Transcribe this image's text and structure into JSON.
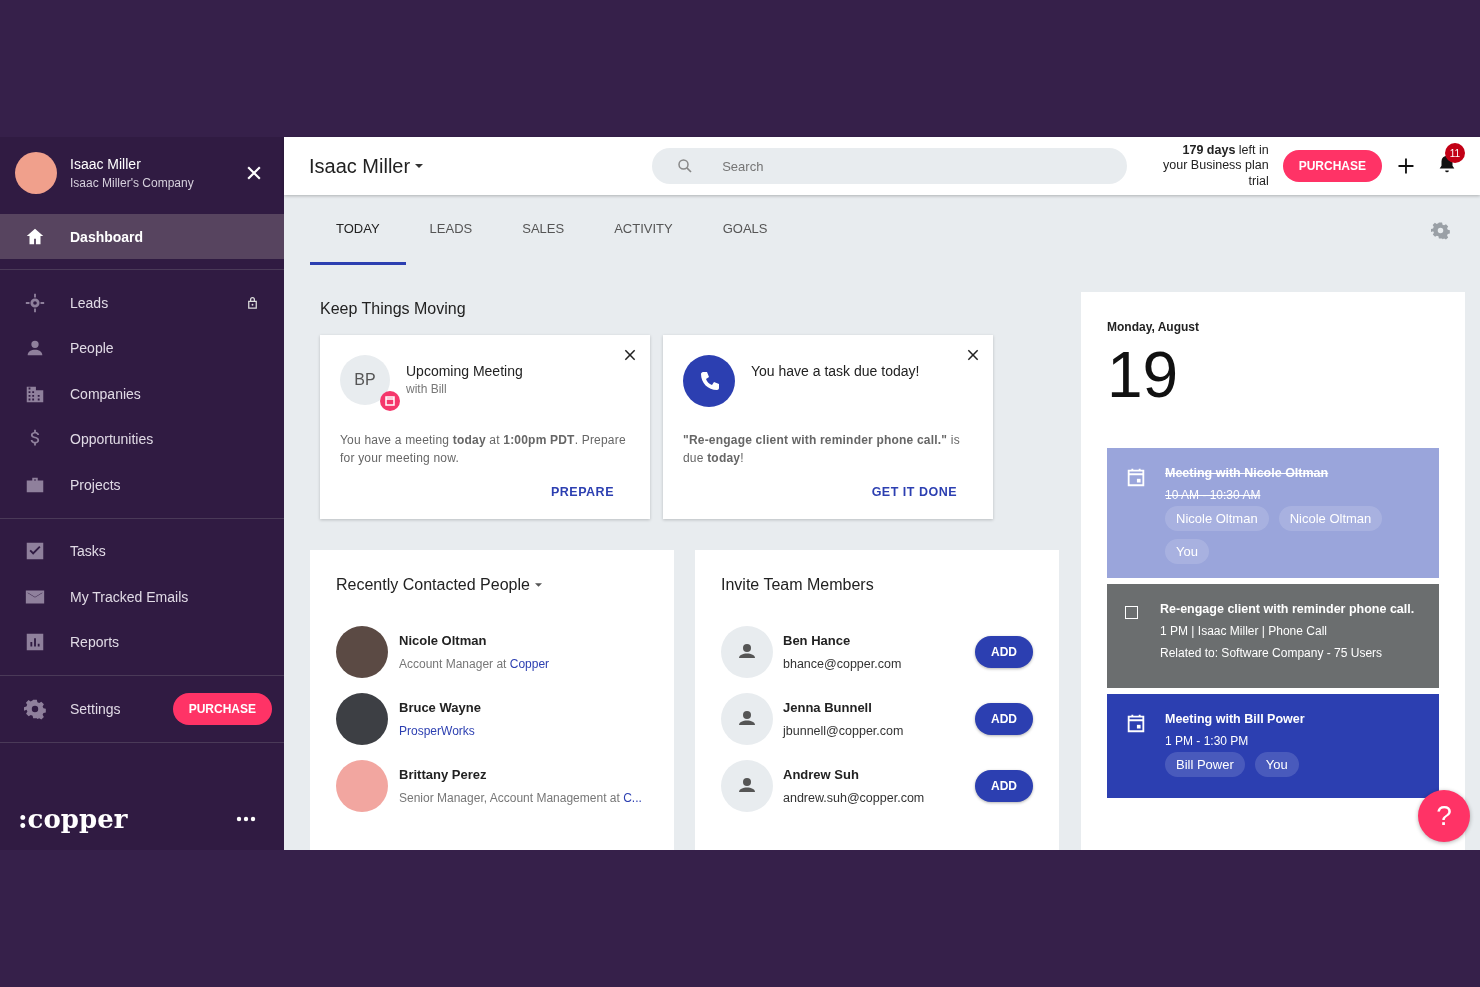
{
  "user": {
    "name": "Isaac Miller",
    "company": "Isaac Miller's Company"
  },
  "sidebar": {
    "sections": [
      {
        "items": [
          {
            "label": "Dashboard",
            "kind": "home",
            "selected": true,
            "locked": false
          }
        ]
      },
      {
        "items": [
          {
            "label": "Leads",
            "kind": "leads",
            "selected": false,
            "locked": true
          },
          {
            "label": "People",
            "kind": "people",
            "selected": false,
            "locked": false
          },
          {
            "label": "Companies",
            "kind": "companies",
            "selected": false,
            "locked": false
          },
          {
            "label": "Opportunities",
            "kind": "opportunities",
            "selected": false,
            "locked": false
          },
          {
            "label": "Projects",
            "kind": "projects",
            "selected": false,
            "locked": false
          }
        ]
      },
      {
        "items": [
          {
            "label": "Tasks",
            "kind": "tasks",
            "selected": false,
            "locked": false
          },
          {
            "label": "My Tracked Emails",
            "kind": "emails",
            "selected": false,
            "locked": false
          },
          {
            "label": "Reports",
            "kind": "reports",
            "selected": false,
            "locked": false
          }
        ]
      },
      {
        "items": [
          {
            "label": "Settings",
            "kind": "settings",
            "selected": false,
            "locked": false,
            "button": "PURCHASE"
          }
        ]
      }
    ]
  },
  "logo": ":copper",
  "header": {
    "title": "Isaac Miller",
    "search": {
      "placeholder": "Search"
    },
    "trial": "**179 days** left in your Business plan trial",
    "purchase": "PURCHASE",
    "notifications": "11"
  },
  "tabs": [
    {
      "label": "TODAY",
      "selected": true
    },
    {
      "label": "LEADS",
      "selected": false
    },
    {
      "label": "SALES",
      "selected": false
    },
    {
      "label": "ACTIVITY",
      "selected": false
    },
    {
      "label": "GOALS",
      "selected": false
    }
  ],
  "keep_moving": {
    "title": "Keep Things Moving",
    "cards": [
      {
        "kind": "meeting",
        "initials": "BP",
        "title": "Upcoming Meeting",
        "subtitle": "with Bill",
        "message": "You have a meeting **today** at **1:00pm PDT**. Prepare for your meeting now.",
        "action": "PREPARE"
      },
      {
        "kind": "task",
        "title": "You have a task due today!",
        "message": "**\"Re-engage client with reminder phone call.\"** is due **today**!",
        "action": "GET IT DONE"
      }
    ]
  },
  "recent": {
    "title": "Recently Contacted People",
    "people": [
      {
        "name": "Nicole Oltman",
        "role": "Account Manager at",
        "company": "Copper"
      },
      {
        "name": "Bruce Wayne",
        "company": "ProsperWorks"
      },
      {
        "name": "Brittany Perez",
        "role": "Senior Manager, Account Management at",
        "company": "C..."
      }
    ]
  },
  "invite": {
    "title": "Invite Team Members",
    "members": [
      {
        "name": "Ben Hance",
        "email": "bhance@copper.com",
        "action": "ADD"
      },
      {
        "name": "Jenna Bunnell",
        "email": "jbunnell@copper.com",
        "action": "ADD"
      },
      {
        "name": "Andrew Suh",
        "email": "andrew.suh@copper.com",
        "action": "ADD"
      }
    ]
  },
  "calendar": {
    "weekday_month": "Monday, August",
    "day": "19",
    "events": [
      {
        "kind": "meeting",
        "done": true,
        "color": "#9aa5db",
        "title": "Meeting with Nicole Oltman",
        "time": "10 AM - 10:30 AM",
        "attendees": [
          "Nicole Oltman",
          "Nicole Oltman",
          "You"
        ]
      },
      {
        "kind": "task",
        "done": false,
        "color": "#6b6e6f",
        "title": "Re-engage client with reminder phone call.",
        "details": [
          "1 PM | Isaac Miller | Phone Call",
          "Related to: Software Company - 75 Users"
        ]
      },
      {
        "kind": "meeting",
        "done": false,
        "color": "#2c3fb1",
        "title": "Meeting with Bill Power",
        "time": "1 PM - 1:30 PM",
        "attendees": [
          "Bill Power",
          "You"
        ]
      }
    ]
  },
  "help": "?"
}
